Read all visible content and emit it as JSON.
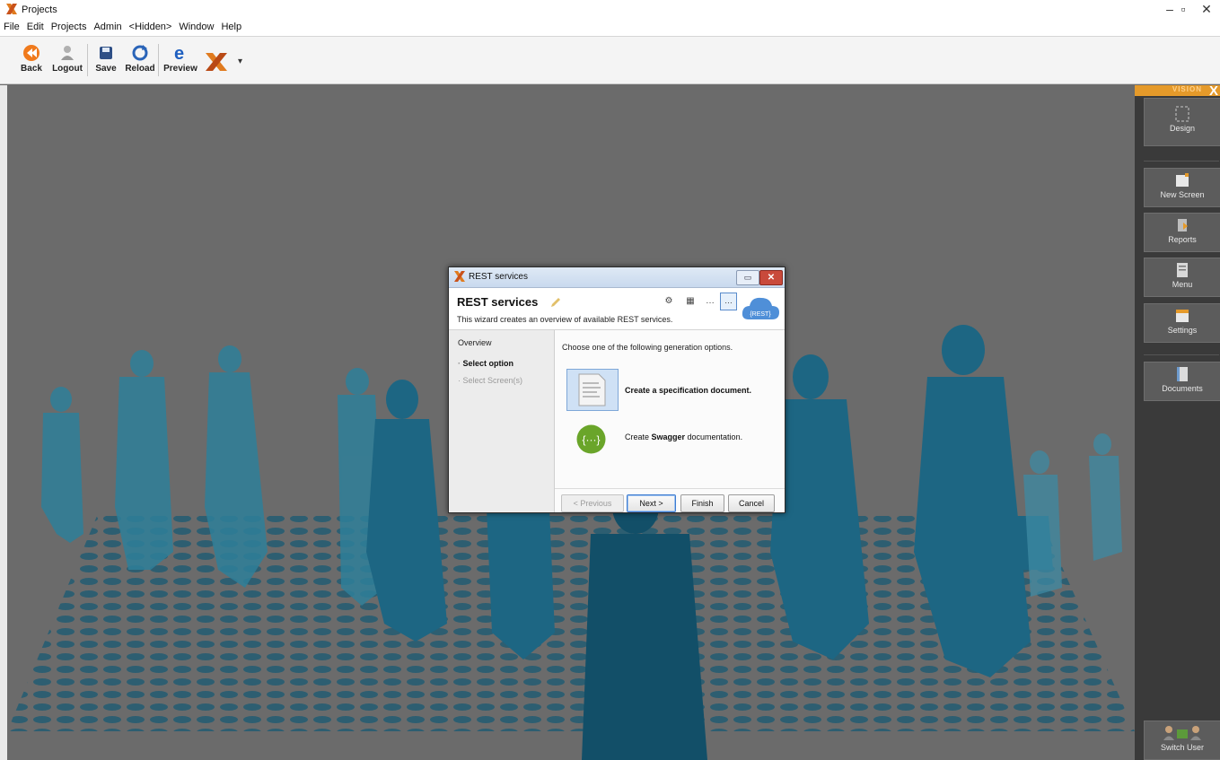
{
  "window": {
    "title": "Projects"
  },
  "menubar": [
    "File",
    "Edit",
    "Projects",
    "Admin",
    "<Hidden>",
    "Window",
    "Help"
  ],
  "toolbar": {
    "back": "Back",
    "logout": "Logout",
    "save": "Save",
    "reload": "Reload",
    "preview": "Preview"
  },
  "right_panel": {
    "brand": "VISION",
    "buttons": [
      {
        "label": "Design",
        "icon": "design-icon"
      },
      {
        "label": "New Screen",
        "icon": "new-screen-icon"
      },
      {
        "label": "Reports",
        "icon": "reports-icon"
      },
      {
        "label": "Menu",
        "icon": "menu-icon"
      },
      {
        "label": "Settings",
        "icon": "settings-icon"
      },
      {
        "label": "Documents",
        "icon": "documents-icon"
      }
    ],
    "switch_user": "Switch User"
  },
  "dialog": {
    "window_title": "REST services",
    "heading": "REST services",
    "subtitle": "This wizard creates an overview of available REST services.",
    "cloud_label": "{REST}",
    "nav_title": "Overview",
    "steps": [
      {
        "label": "Select option",
        "active": true
      },
      {
        "label": "Select Screen(s)",
        "active": false
      }
    ],
    "prompt": "Choose one of the following generation options.",
    "option1": "Create a specification document.",
    "option2_prefix": "Create ",
    "option2_bold": "Swagger",
    "option2_suffix": " documentation.",
    "buttons": {
      "previous": "< Previous",
      "next": "Next >",
      "finish": "Finish",
      "cancel": "Cancel"
    }
  },
  "colors": {
    "accent": "#e59a2a",
    "canvas_dim": "#6b6b6b",
    "silhouette": "#1f6c87",
    "dialog_selected": "#cfe1f5",
    "swagger_green": "#6aa52a"
  }
}
